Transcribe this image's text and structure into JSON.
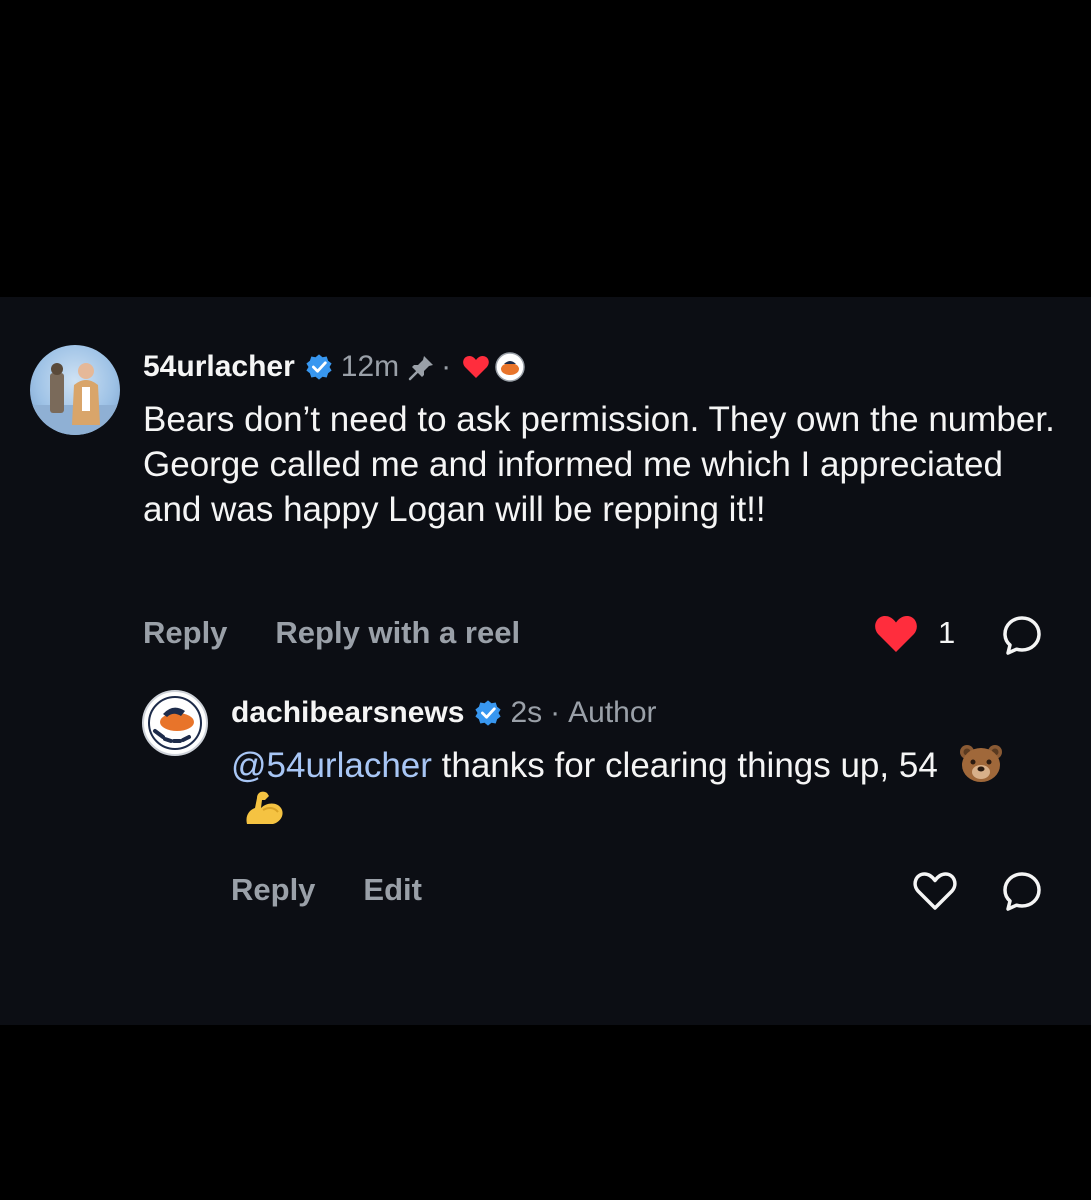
{
  "colors": {
    "background": "#000000",
    "panel": "#0c0e14",
    "primary_text": "#f5f5f5",
    "muted_text": "#9aa0a8",
    "verified_blue": "#3897f0",
    "like_red": "#ff2d3d",
    "mention": "#a8c6f5"
  },
  "comment": {
    "username": "54urlacher",
    "time": "12m",
    "separator": "·",
    "text": "Bears don’t need to ask permission. They own the number. George called me and informed me which I appreciated and was happy Logan will be repping it!!",
    "actions": {
      "reply_label": "Reply",
      "reply_reel_label": "Reply with a reel",
      "like_count": "1"
    },
    "icons": {
      "verified": "verified-badge-icon",
      "pinned": "pin-icon",
      "creator_liked": "heart-icon",
      "like": "heart-filled-icon",
      "reply": "comment-bubble-icon"
    }
  },
  "reply": {
    "username": "dachibearsnews",
    "time": "2s",
    "separator": "·",
    "author_label": "Author",
    "mention": "@54urlacher",
    "text_rest": " thanks for clearing things up, 54",
    "emojis": [
      "bear-face-emoji",
      "flexed-biceps-emoji"
    ],
    "actions": {
      "reply_label": "Reply",
      "edit_label": "Edit"
    },
    "icons": {
      "verified": "verified-badge-icon",
      "like": "heart-outline-icon",
      "reply": "comment-bubble-icon"
    }
  }
}
